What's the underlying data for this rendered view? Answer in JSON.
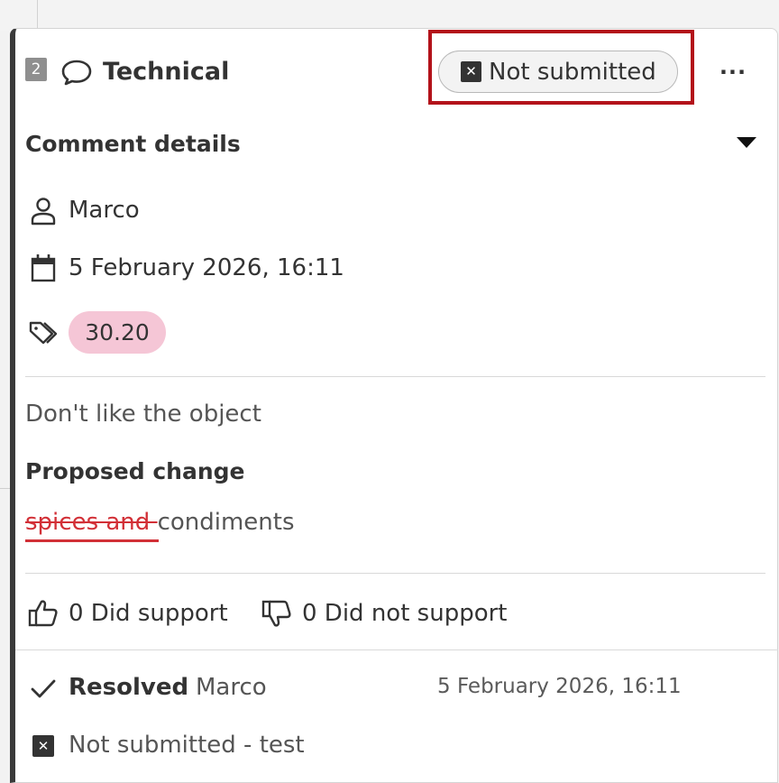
{
  "header": {
    "number": "2",
    "title": "Technical",
    "status": "Not submitted",
    "more_menu": "···"
  },
  "details": {
    "section_title": "Comment details",
    "author": "Marco",
    "datetime": "5 February 2026, 16:11",
    "tag": "30.20"
  },
  "comment": {
    "text": "Don't like the object",
    "proposed_title": "Proposed change",
    "removed_text": "spices and ",
    "kept_text": "condiments"
  },
  "votes": {
    "support_label": "0 Did support",
    "not_support_label": "0 Did not support"
  },
  "resolution": {
    "status_label": "Resolved",
    "by": "Marco",
    "datetime": "5 February 2026, 16:11",
    "note": "Not submitted - test"
  },
  "colors": {
    "highlight": "#b3121a",
    "tag_bg": "#f5c6d6",
    "strike": "#d23037"
  }
}
